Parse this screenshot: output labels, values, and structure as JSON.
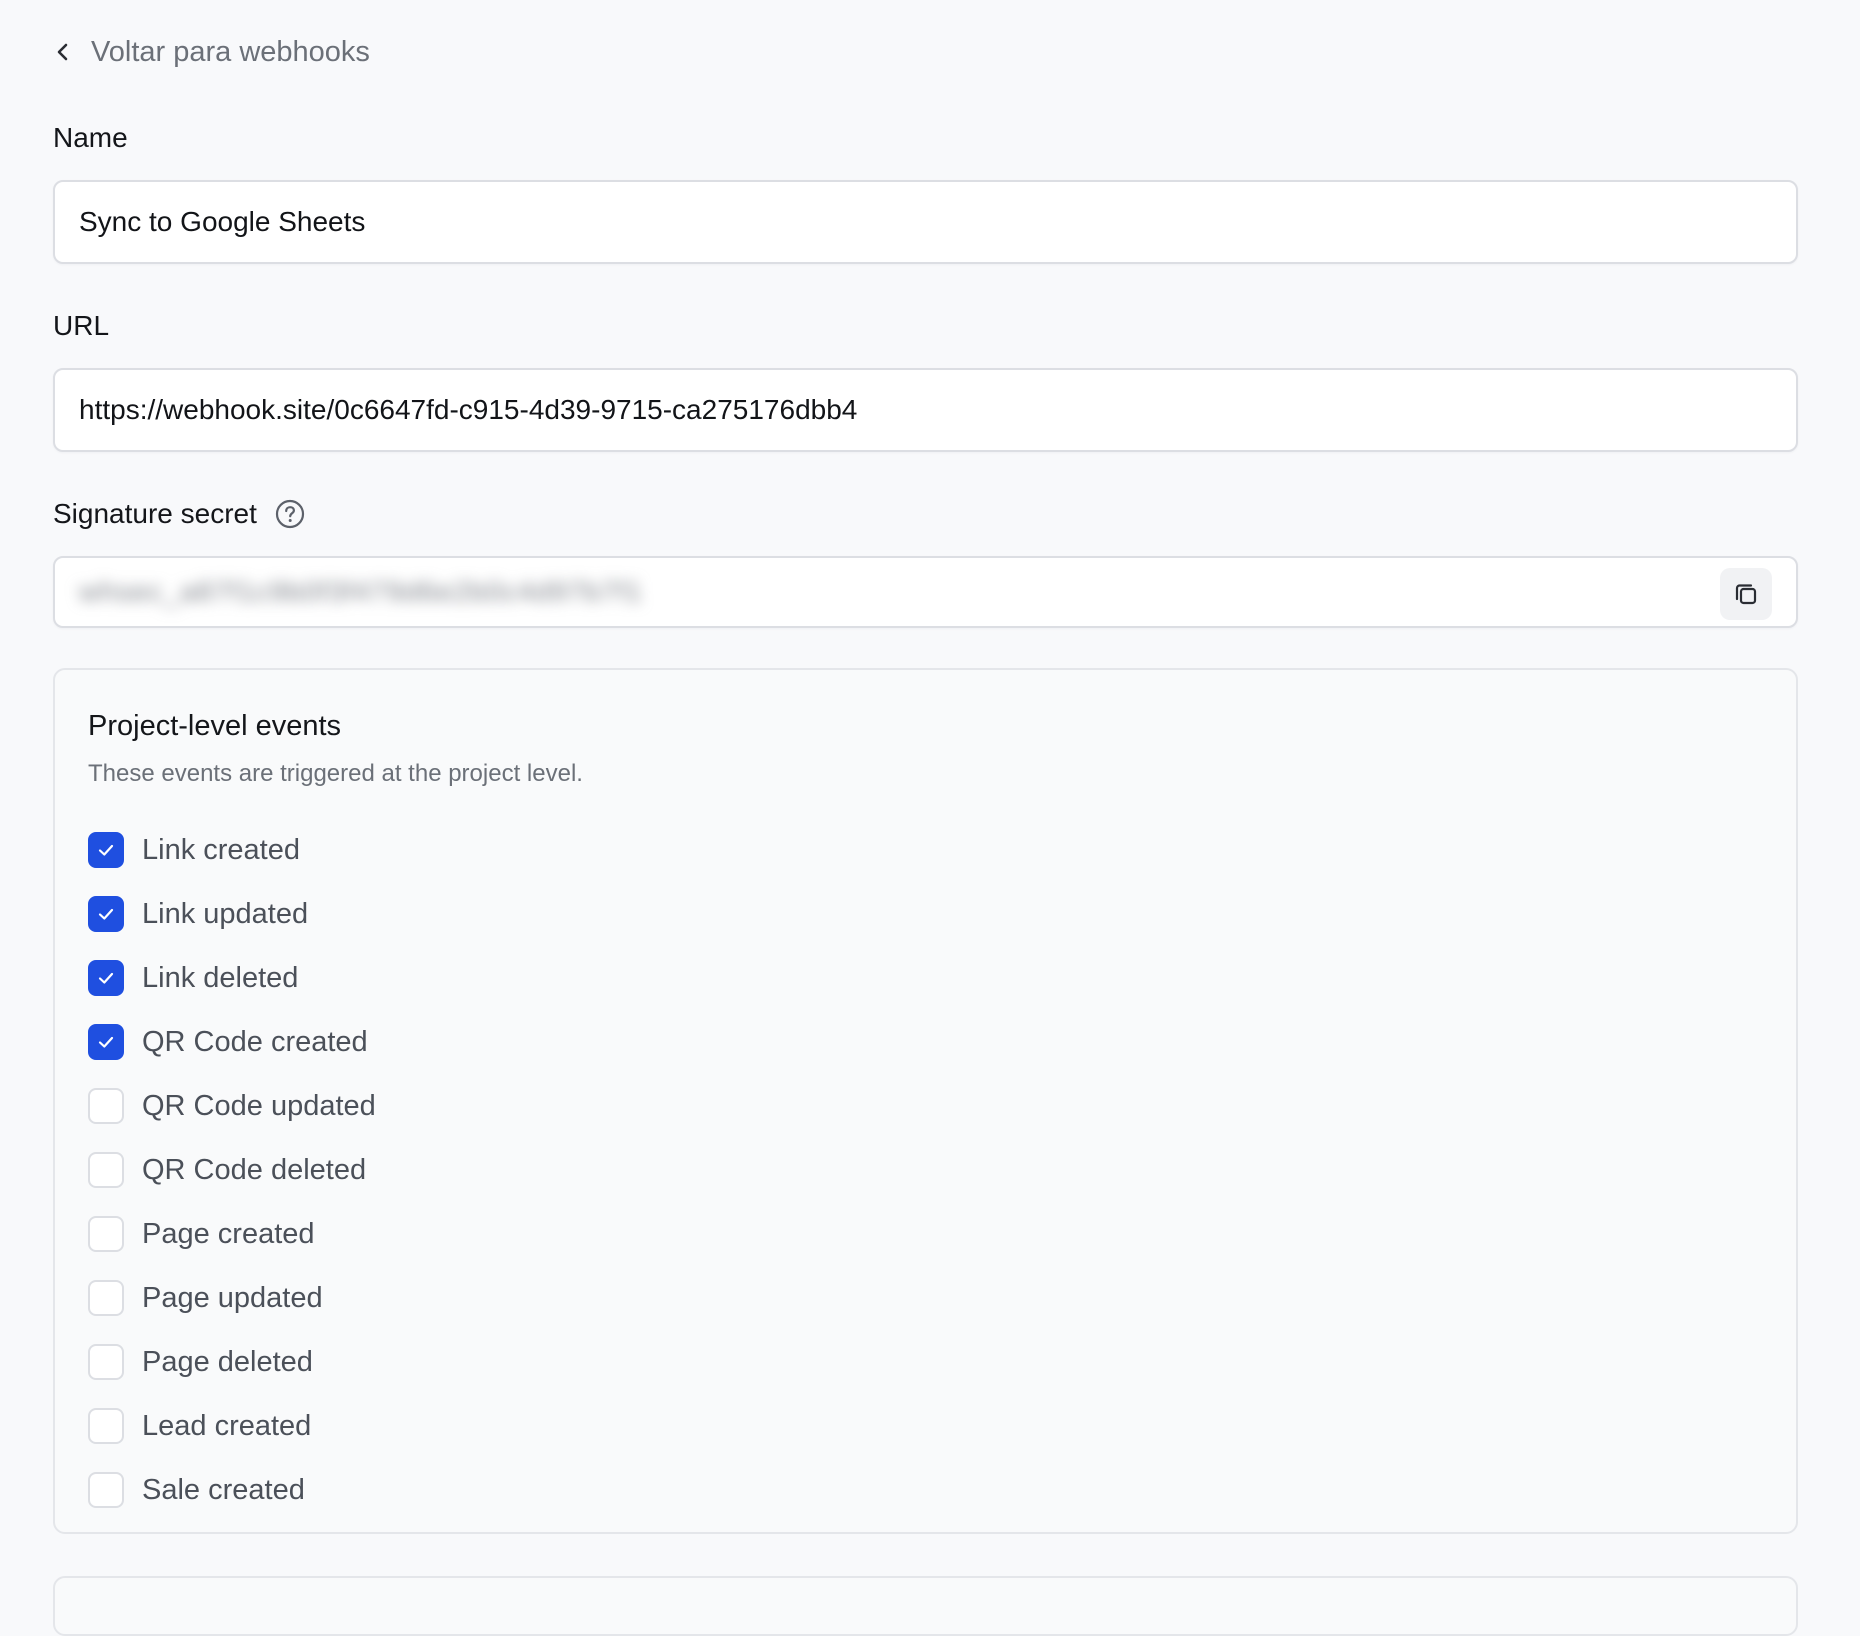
{
  "back_link": {
    "label": "Voltar para webhooks"
  },
  "name_field": {
    "label": "Name",
    "value": "Sync to Google Sheets"
  },
  "url_field": {
    "label": "URL",
    "value": "https://webhook.site/0c6647fd-c915-4d39-9715-ca275176dbb4"
  },
  "secret_field": {
    "label": "Signature secret",
    "value": "whsec_a87f1c9b0f3f479d6e2b0c4d97b7f1",
    "help_icon": "question-circle-icon",
    "copy_icon": "copy-icon"
  },
  "project_events": {
    "title": "Project-level events",
    "description": "These events are triggered at the project level.",
    "items": [
      {
        "label": "Link created",
        "checked": true
      },
      {
        "label": "Link updated",
        "checked": true
      },
      {
        "label": "Link deleted",
        "checked": true
      },
      {
        "label": "QR Code created",
        "checked": true
      },
      {
        "label": "QR Code updated",
        "checked": false
      },
      {
        "label": "QR Code deleted",
        "checked": false
      },
      {
        "label": "Page created",
        "checked": false
      },
      {
        "label": "Page updated",
        "checked": false
      },
      {
        "label": "Page deleted",
        "checked": false
      },
      {
        "label": "Lead created",
        "checked": false
      },
      {
        "label": "Sale created",
        "checked": false
      }
    ]
  },
  "colors": {
    "accent": "#1f4fe0",
    "background": "#f8f9fb",
    "border": "#dcdee3",
    "muted_text": "#6b7078"
  }
}
